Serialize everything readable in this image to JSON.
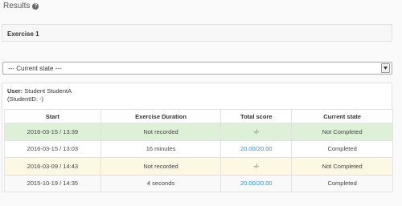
{
  "header": {
    "title": "Results",
    "help_icon": "question-circle-icon"
  },
  "exercise": {
    "label": "Exercise 1"
  },
  "state_filter": {
    "selected": "--- Current state ---"
  },
  "user": {
    "label": "User:",
    "name": "Student StudentA",
    "student_id": "(StudentID: -)"
  },
  "table": {
    "headers": [
      "Start",
      "Exercise Duration",
      "Total score",
      "Current state"
    ],
    "rows": [
      {
        "start": "2016-03-15 / 13:39",
        "duration": "Not recorded",
        "score": "-/-",
        "state": "Not Completed",
        "style": "success"
      },
      {
        "start": "2016-03-15 / 13:03",
        "duration": "16 minutes",
        "score": "20.00/20.00",
        "state": "Completed",
        "style": "default"
      },
      {
        "start": "2016-03-09 / 14:43",
        "duration": "Not recorded",
        "score": "-/-",
        "state": "Not Completed",
        "style": "warning"
      },
      {
        "start": "2015-10-19 / 14:35",
        "duration": "4 seconds",
        "score": "20.00/20.00",
        "state": "Completed",
        "style": "alt"
      }
    ]
  },
  "colors": {
    "success_row": "#dff0d8",
    "warning_row": "#fcf8e3",
    "link": "#3a8fd1"
  }
}
